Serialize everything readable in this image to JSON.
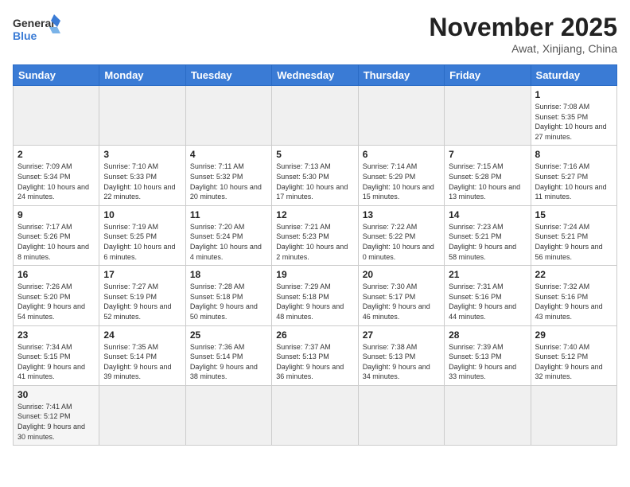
{
  "header": {
    "logo_general": "General",
    "logo_blue": "Blue",
    "month_title": "November 2025",
    "location": "Awat, Xinjiang, China"
  },
  "weekdays": [
    "Sunday",
    "Monday",
    "Tuesday",
    "Wednesday",
    "Thursday",
    "Friday",
    "Saturday"
  ],
  "weeks": [
    [
      {
        "day": "",
        "info": "",
        "empty": true
      },
      {
        "day": "",
        "info": "",
        "empty": true
      },
      {
        "day": "",
        "info": "",
        "empty": true
      },
      {
        "day": "",
        "info": "",
        "empty": true
      },
      {
        "day": "",
        "info": "",
        "empty": true
      },
      {
        "day": "",
        "info": "",
        "empty": true
      },
      {
        "day": "1",
        "info": "Sunrise: 7:08 AM\nSunset: 5:35 PM\nDaylight: 10 hours and 27 minutes."
      }
    ],
    [
      {
        "day": "2",
        "info": "Sunrise: 7:09 AM\nSunset: 5:34 PM\nDaylight: 10 hours and 24 minutes."
      },
      {
        "day": "3",
        "info": "Sunrise: 7:10 AM\nSunset: 5:33 PM\nDaylight: 10 hours and 22 minutes."
      },
      {
        "day": "4",
        "info": "Sunrise: 7:11 AM\nSunset: 5:32 PM\nDaylight: 10 hours and 20 minutes."
      },
      {
        "day": "5",
        "info": "Sunrise: 7:13 AM\nSunset: 5:30 PM\nDaylight: 10 hours and 17 minutes."
      },
      {
        "day": "6",
        "info": "Sunrise: 7:14 AM\nSunset: 5:29 PM\nDaylight: 10 hours and 15 minutes."
      },
      {
        "day": "7",
        "info": "Sunrise: 7:15 AM\nSunset: 5:28 PM\nDaylight: 10 hours and 13 minutes."
      },
      {
        "day": "8",
        "info": "Sunrise: 7:16 AM\nSunset: 5:27 PM\nDaylight: 10 hours and 11 minutes."
      }
    ],
    [
      {
        "day": "9",
        "info": "Sunrise: 7:17 AM\nSunset: 5:26 PM\nDaylight: 10 hours and 8 minutes."
      },
      {
        "day": "10",
        "info": "Sunrise: 7:19 AM\nSunset: 5:25 PM\nDaylight: 10 hours and 6 minutes."
      },
      {
        "day": "11",
        "info": "Sunrise: 7:20 AM\nSunset: 5:24 PM\nDaylight: 10 hours and 4 minutes."
      },
      {
        "day": "12",
        "info": "Sunrise: 7:21 AM\nSunset: 5:23 PM\nDaylight: 10 hours and 2 minutes."
      },
      {
        "day": "13",
        "info": "Sunrise: 7:22 AM\nSunset: 5:22 PM\nDaylight: 10 hours and 0 minutes."
      },
      {
        "day": "14",
        "info": "Sunrise: 7:23 AM\nSunset: 5:21 PM\nDaylight: 9 hours and 58 minutes."
      },
      {
        "day": "15",
        "info": "Sunrise: 7:24 AM\nSunset: 5:21 PM\nDaylight: 9 hours and 56 minutes."
      }
    ],
    [
      {
        "day": "16",
        "info": "Sunrise: 7:26 AM\nSunset: 5:20 PM\nDaylight: 9 hours and 54 minutes."
      },
      {
        "day": "17",
        "info": "Sunrise: 7:27 AM\nSunset: 5:19 PM\nDaylight: 9 hours and 52 minutes."
      },
      {
        "day": "18",
        "info": "Sunrise: 7:28 AM\nSunset: 5:18 PM\nDaylight: 9 hours and 50 minutes."
      },
      {
        "day": "19",
        "info": "Sunrise: 7:29 AM\nSunset: 5:18 PM\nDaylight: 9 hours and 48 minutes."
      },
      {
        "day": "20",
        "info": "Sunrise: 7:30 AM\nSunset: 5:17 PM\nDaylight: 9 hours and 46 minutes."
      },
      {
        "day": "21",
        "info": "Sunrise: 7:31 AM\nSunset: 5:16 PM\nDaylight: 9 hours and 44 minutes."
      },
      {
        "day": "22",
        "info": "Sunrise: 7:32 AM\nSunset: 5:16 PM\nDaylight: 9 hours and 43 minutes."
      }
    ],
    [
      {
        "day": "23",
        "info": "Sunrise: 7:34 AM\nSunset: 5:15 PM\nDaylight: 9 hours and 41 minutes."
      },
      {
        "day": "24",
        "info": "Sunrise: 7:35 AM\nSunset: 5:14 PM\nDaylight: 9 hours and 39 minutes."
      },
      {
        "day": "25",
        "info": "Sunrise: 7:36 AM\nSunset: 5:14 PM\nDaylight: 9 hours and 38 minutes."
      },
      {
        "day": "26",
        "info": "Sunrise: 7:37 AM\nSunset: 5:13 PM\nDaylight: 9 hours and 36 minutes."
      },
      {
        "day": "27",
        "info": "Sunrise: 7:38 AM\nSunset: 5:13 PM\nDaylight: 9 hours and 34 minutes."
      },
      {
        "day": "28",
        "info": "Sunrise: 7:39 AM\nSunset: 5:13 PM\nDaylight: 9 hours and 33 minutes."
      },
      {
        "day": "29",
        "info": "Sunrise: 7:40 AM\nSunset: 5:12 PM\nDaylight: 9 hours and 32 minutes."
      }
    ],
    [
      {
        "day": "30",
        "info": "Sunrise: 7:41 AM\nSunset: 5:12 PM\nDaylight: 9 hours and 30 minutes."
      },
      {
        "day": "",
        "info": "",
        "empty": true
      },
      {
        "day": "",
        "info": "",
        "empty": true
      },
      {
        "day": "",
        "info": "",
        "empty": true
      },
      {
        "day": "",
        "info": "",
        "empty": true
      },
      {
        "day": "",
        "info": "",
        "empty": true
      },
      {
        "day": "",
        "info": "",
        "empty": true
      }
    ]
  ]
}
